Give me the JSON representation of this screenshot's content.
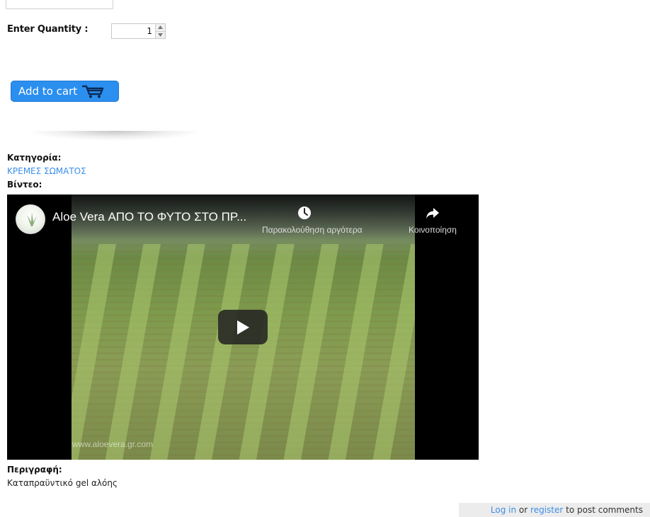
{
  "quantity": {
    "label": "Enter Quantity :",
    "value": "1"
  },
  "cart": {
    "button_label": "Add to cart",
    "icon": "cart-icon",
    "button_color": "#2b8ff0"
  },
  "product": {
    "category_label": "Κατηγορία:",
    "category_value": "ΚΡΕΜΕΣ ΣΩΜΑΤΟΣ",
    "video_label": "Βίντεο:",
    "description_label": "Περιγραφή:",
    "description_value": "Καταπραϋντικό gel αλόης"
  },
  "video": {
    "title": "Aloe Vera ΑΠΟ ΤΟ ΦΥΤΟ ΣΤΟ ΠΡ...",
    "watch_later_label": "Παρακολούθηση αργότερα",
    "share_label": "Κοινοποίηση",
    "watermark": "www.aloevera.gr.com",
    "icons": {
      "watch_later": "clock-icon",
      "share": "share-arrow-icon",
      "play": "play-icon"
    }
  },
  "comments": {
    "login_label": "Log in",
    "or_text": "or",
    "register_label": "register",
    "suffix": "to post comments"
  },
  "colors": {
    "link": "#3b8fe8",
    "comments_bar_bg": "#ececec"
  }
}
